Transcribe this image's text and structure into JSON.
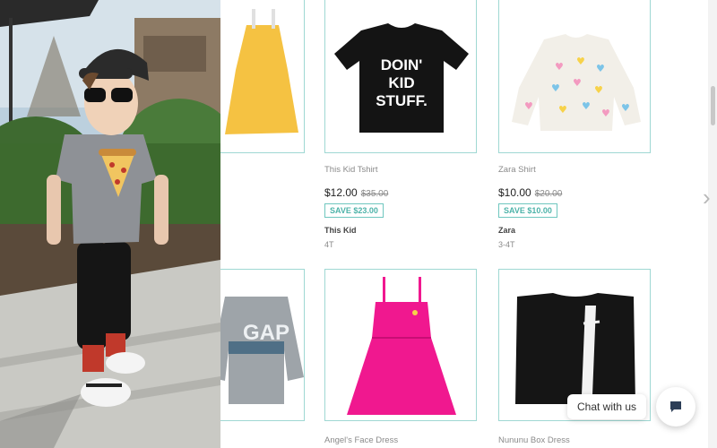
{
  "hero": {
    "image_name": "boy-in-pizza-tshirt-photo"
  },
  "products": [
    {
      "name": "This Kid Tshirt",
      "price": "$12.00",
      "original_price": "$35.00",
      "save": "SAVE $23.00",
      "brand": "This Kid",
      "size": "4T",
      "tee_text": [
        "DOIN'",
        "KID",
        "STUFF."
      ]
    },
    {
      "name": "Zara Shirt",
      "price": "$10.00",
      "original_price": "$20.00",
      "save": "SAVE $10.00",
      "brand": "Zara",
      "size": "3-4T"
    },
    {
      "name": "Angel's Face Dress"
    },
    {
      "name": "Nununu Box Dress"
    }
  ],
  "chat": {
    "label": "Chat with us",
    "icon": "chat-bubble-icon"
  },
  "navigation": {
    "next_icon": "chevron-right-icon",
    "next_glyph": "›"
  },
  "colors": {
    "accent": "#9fd8d3",
    "save_text": "#4db3a9",
    "dress_pink": "#f0188f"
  }
}
